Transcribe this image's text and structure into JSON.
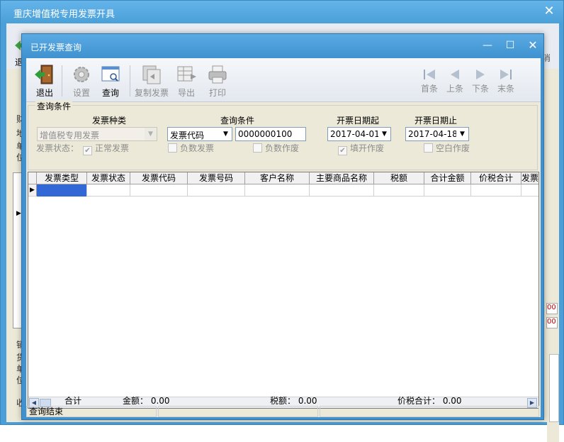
{
  "bg_window": {
    "title": "重庆增值税专用发票开具",
    "close_icon": "close-icon",
    "exit_fragment": "退",
    "right_fragment": "消",
    "left_fragments": [
      "财",
      "地",
      "单",
      "位"
    ],
    "left_fragments_lower": [
      "销",
      "货",
      "单",
      "位"
    ],
    "left_fragment_bottom": "收",
    "red_marks": [
      "00",
      "00"
    ]
  },
  "dialog": {
    "title": "已开发票查询",
    "minimize_icon": "minimize-icon",
    "maximize_icon": "maximize-icon",
    "close_icon": "close-icon"
  },
  "toolbar": {
    "exit_label": "退出",
    "settings_label": "设置",
    "query_label": "查询",
    "copy_label": "复制发票",
    "export_label": "导出",
    "print_label": "打印",
    "first_label": "首条",
    "prev_label": "上条",
    "next_label": "下条",
    "last_label": "末条"
  },
  "query": {
    "group_title": "查询条件",
    "invoice_type_label": "发票种类",
    "invoice_type_value": "增值税专用发票",
    "condition_label": "查询条件",
    "condition_field": "发票代码",
    "condition_value": "0000000100",
    "date_from_label": "开票日期起",
    "date_from_value": "2017-04-01",
    "date_to_label": "开票日期止",
    "date_to_value": "2017-04-18"
  },
  "status": {
    "label": "发票状态：",
    "options": [
      {
        "label": "正常发票",
        "checked": true
      },
      {
        "label": "负数发票",
        "checked": false
      },
      {
        "label": "负数作废",
        "checked": false
      },
      {
        "label": "填开作废",
        "checked": true
      },
      {
        "label": "空白作废",
        "checked": false
      }
    ]
  },
  "grid": {
    "columns": [
      "发票类型",
      "发票状态",
      "发票代码",
      "发票号码",
      "客户名称",
      "主要商品名称",
      "税额",
      "合计金额",
      "价税合计",
      "发票代"
    ]
  },
  "totals": {
    "label": "合计",
    "amount": "金额： 0.00",
    "tax": "税额： 0.00",
    "total": "价税合计： 0.00"
  },
  "statusbar": {
    "message": "查询结束"
  }
}
